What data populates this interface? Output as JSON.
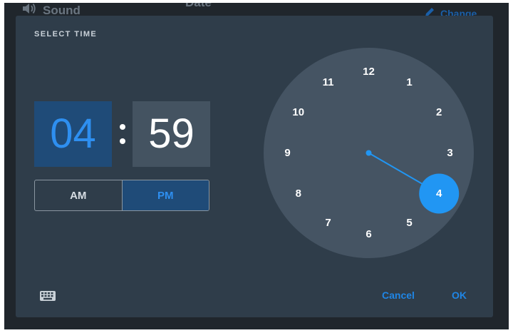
{
  "background": {
    "sound_label": "Sound",
    "date_label": "Date",
    "change_label": "Change"
  },
  "dialog": {
    "title": "SELECT TIME",
    "hour": "04",
    "separator": ":",
    "minute": "59",
    "am_label": "AM",
    "pm_label": "PM",
    "selected_period": "PM",
    "cancel_label": "Cancel",
    "ok_label": "OK"
  },
  "clock": {
    "numbers": [
      "12",
      "1",
      "2",
      "3",
      "4",
      "5",
      "6",
      "7",
      "8",
      "9",
      "10",
      "11"
    ],
    "selected_hour": 4
  },
  "colors": {
    "accent": "#2196f3",
    "dialog_bg": "#2f3d4a",
    "clock_face": "#455463"
  },
  "icons": {
    "sound": "speaker-icon",
    "change": "pencil-icon",
    "keyboard": "keyboard-icon"
  }
}
